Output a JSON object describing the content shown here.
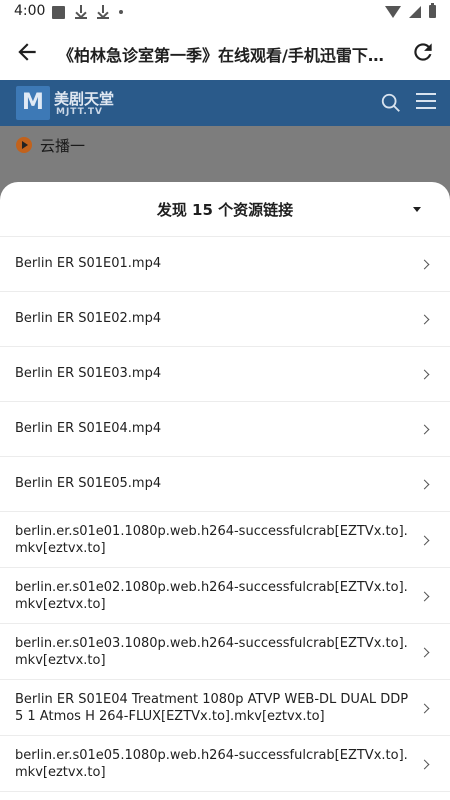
{
  "status_bar": {
    "time": "4:00"
  },
  "app_bar": {
    "title": "《柏林急诊室第一季》在线观看/手机迅雷下载..."
  },
  "web": {
    "site_name": "美剧天堂",
    "site_domain": "MJTT.TV",
    "logo_letter": "M",
    "section": "云播一"
  },
  "sheet": {
    "title": "发现 15 个资源链接",
    "items": [
      {
        "label": "Berlin ER S01E01.mp4"
      },
      {
        "label": "Berlin ER S01E02.mp4"
      },
      {
        "label": "Berlin ER S01E03.mp4"
      },
      {
        "label": "Berlin ER S01E04.mp4"
      },
      {
        "label": "Berlin ER S01E05.mp4"
      },
      {
        "label": "berlin.er.s01e01.1080p.web.h264-successfulcrab[EZTVx.to].mkv[eztvx.to]"
      },
      {
        "label": "berlin.er.s01e02.1080p.web.h264-successfulcrab[EZTVx.to].mkv[eztvx.to]"
      },
      {
        "label": "berlin.er.s01e03.1080p.web.h264-successfulcrab[EZTVx.to].mkv[eztvx.to]"
      },
      {
        "label": "Berlin ER S01E04 Treatment 1080p ATVP WEB-DL DUAL DDP5 1 Atmos H 264-FLUX[EZTVx.to].mkv[eztvx.to]"
      },
      {
        "label": "berlin.er.s01e05.1080p.web.h264-successfulcrab[EZTVx.to].mkv[eztvx.to]"
      }
    ]
  },
  "colors": {
    "site_header": "#2a5a8a",
    "dim_overlay": "#7d7d7d",
    "accent_play": "#c2621c"
  }
}
